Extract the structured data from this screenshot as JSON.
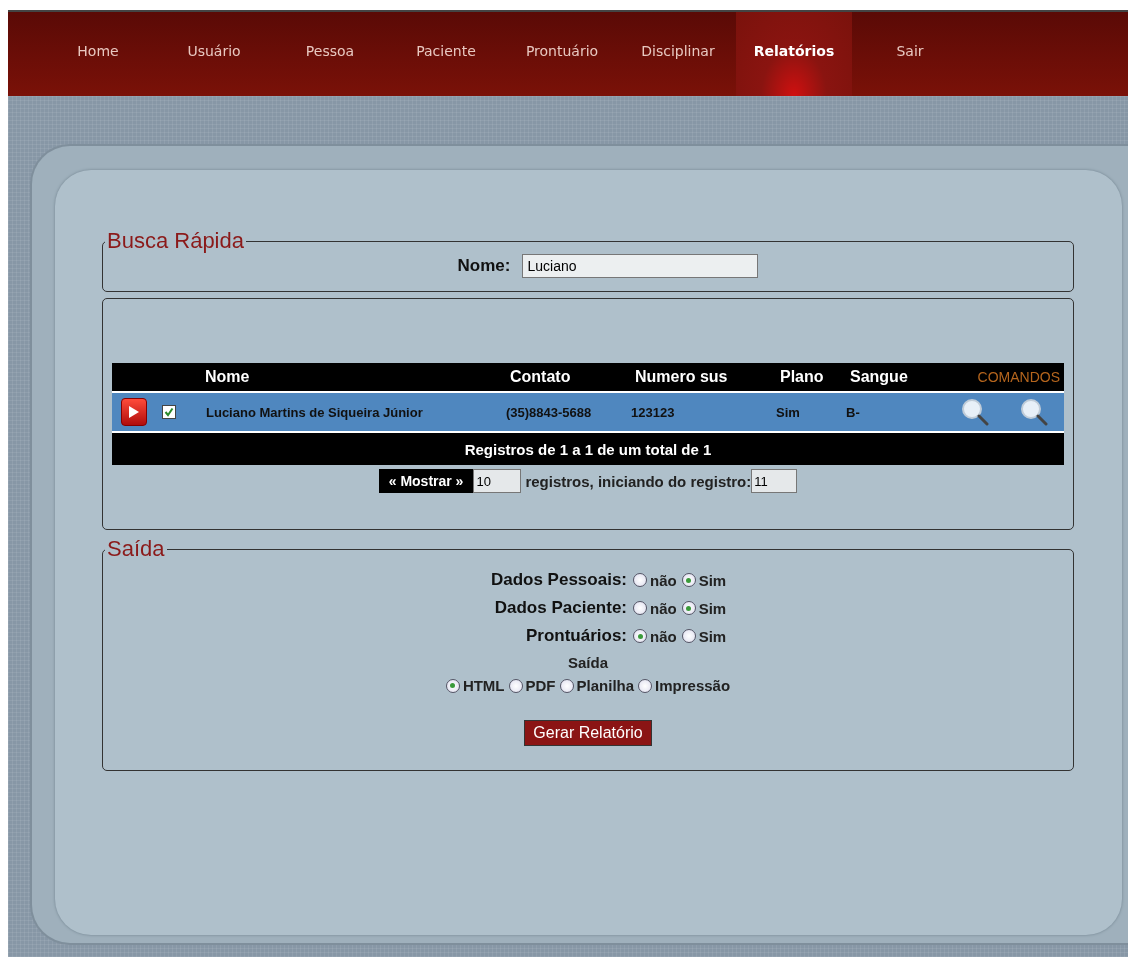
{
  "nav": [
    {
      "label": "Home",
      "selected": false
    },
    {
      "label": "Usuário",
      "selected": false
    },
    {
      "label": "Pessoa",
      "selected": false
    },
    {
      "label": "Paciente",
      "selected": false
    },
    {
      "label": "Prontuário",
      "selected": false
    },
    {
      "label": "Disciplinar",
      "selected": false
    },
    {
      "label": "Relatórios",
      "selected": true
    },
    {
      "label": "Sair",
      "selected": false
    }
  ],
  "search": {
    "legend": "Busca Rápida",
    "label": "Nome:",
    "value": "Luciano"
  },
  "table": {
    "columns": [
      "Nome",
      "Contato",
      "Numero sus",
      "Plano",
      "Sangue"
    ],
    "commands_header": "COMANDOS",
    "rows": [
      {
        "checked": true,
        "cells": [
          "Luciano Martins de Siqueira Júnior",
          "(35)8843-5688",
          "123123",
          "Sim",
          "B-"
        ]
      }
    ],
    "footer": "Registros de 1 a 1 de um total de 1"
  },
  "pagination": {
    "button": "« Mostrar »",
    "count": "10",
    "text": "registros, iniciando do registro:",
    "start": "11"
  },
  "output": {
    "legend": "Saída",
    "options": [
      {
        "label": "Dados Pessoais:",
        "choices": [
          {
            "label": "não",
            "selected": false
          },
          {
            "label": "Sim",
            "selected": true
          }
        ]
      },
      {
        "label": "Dados Paciente:",
        "choices": [
          {
            "label": "não",
            "selected": false
          },
          {
            "label": "Sim",
            "selected": true
          }
        ]
      },
      {
        "label": "Prontuários:",
        "choices": [
          {
            "label": "não",
            "selected": true
          },
          {
            "label": "Sim",
            "selected": false
          }
        ]
      }
    ],
    "format_title": "Saída",
    "formats": [
      {
        "label": "HTML",
        "selected": true
      },
      {
        "label": "PDF",
        "selected": false
      },
      {
        "label": "Planilha",
        "selected": false
      },
      {
        "label": "Impressão",
        "selected": false
      }
    ],
    "button": "Gerar Relatório"
  }
}
